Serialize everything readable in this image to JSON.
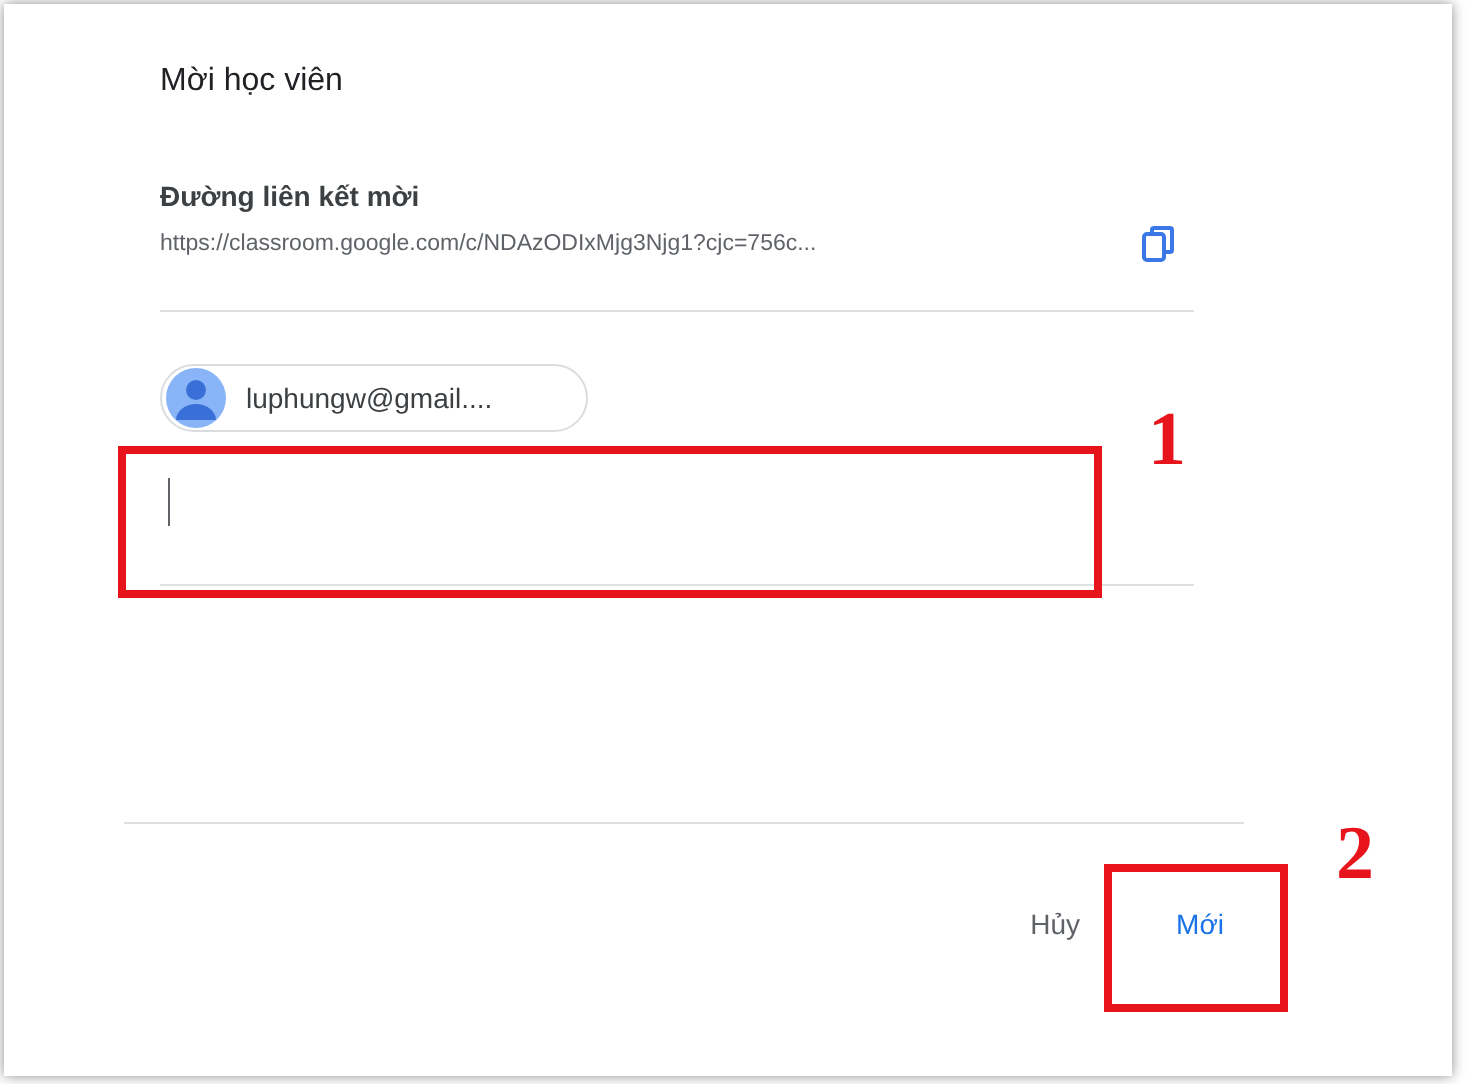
{
  "dialog": {
    "title": "Mời học viên",
    "invite_link": {
      "label": "Đường liên kết mời",
      "url": "https://classroom.google.com/c/NDAzODIxMjg3Njg1?cjc=756c..."
    },
    "recipients": [
      {
        "email": "luphungw@gmail...."
      }
    ],
    "buttons": [
      {
        "label": "Hủy",
        "kind": "cancel"
      },
      {
        "label": "Mới",
        "kind": "primary"
      }
    ]
  },
  "annotations": [
    {
      "number": "1",
      "kind": "field"
    },
    {
      "number": "2",
      "kind": "button"
    }
  ]
}
